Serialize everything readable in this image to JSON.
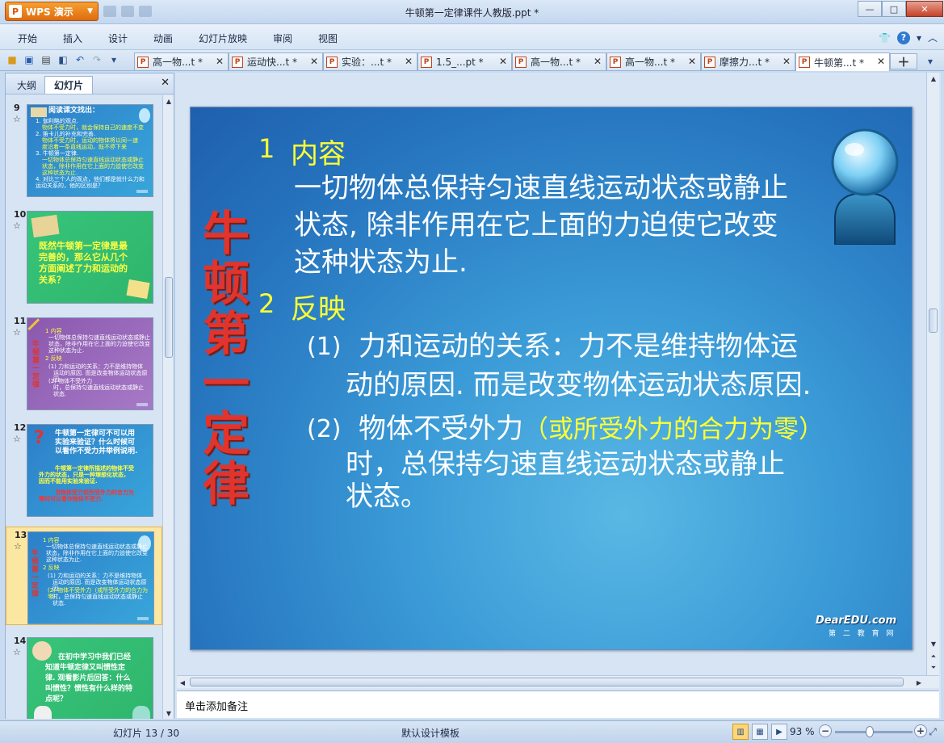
{
  "app": {
    "name": "WPS 演示",
    "logo_letter": "P",
    "window_title": "牛顿第一定律课件人教版.ppt *"
  },
  "menu": [
    "开始",
    "插入",
    "设计",
    "动画",
    "幻灯片放映",
    "审阅",
    "视图"
  ],
  "tabs": [
    {
      "label": "高一物...t *",
      "active": false
    },
    {
      "label": "运动快...t *",
      "active": false
    },
    {
      "label": "实验：...t *",
      "active": false
    },
    {
      "label": "1.5_...pt *",
      "active": false
    },
    {
      "label": "高一物...t *",
      "active": false
    },
    {
      "label": "高一物...t *",
      "active": false
    },
    {
      "label": "摩擦力...t *",
      "active": false
    },
    {
      "label": "牛顿第...t *",
      "active": true
    }
  ],
  "left_panel": {
    "tab_outline": "大纲",
    "tab_slides": "幻灯片"
  },
  "thumbnails": [
    {
      "num": "9",
      "title": "阅读课文找出：",
      "lines": [
        "1. 伽利略的观点.",
        "物体不受力时，就会保持自己的速度不变",
        "2. 笛卡儿的补充和完善.",
        "物体不受力时，运动的物体将以同一速",
        "度沿着一条直线运动，既不停下来",
        "3. 牛顿第一定律.",
        "一切物体总保持匀速直线运动状态或静止",
        "状态，除非作用在它上面的力迫使它改变",
        "这种状态为止.",
        "4. 对比三个人的观点，他们都是就什么力和",
        "运动关系的，他的区别是？"
      ]
    },
    {
      "num": "10",
      "lines": [
        "既然牛顿第一定律是最",
        "完善的，那么它从几个",
        "方面阐述了力和运动的",
        "关系？"
      ]
    },
    {
      "num": "11",
      "lines": [
        "1 内容",
        "一切物体总保持匀速直线运动状态或静止",
        "状态，除非作用在它上面的力迫使它改变",
        "这种状态为止.",
        "2 反映",
        "(1) 力和运动的关系：力不是维持物体",
        "运动的原因. 而是改变物体运动状态原因.",
        "(2) 物体不受外力",
        "时，总保持匀速直线运动状态或静止",
        "状态."
      ],
      "vertical": "牛顿第一定律"
    },
    {
      "num": "12",
      "lines": [
        "牛顿第一定律可不可以用",
        "实验来验证？什么时候可",
        "以看作不受力并举例说明.",
        "牛顿第一定律所描述的物体不受",
        "外力的状态，只是一种理想化状态，",
        "因而不能用实验来验证.",
        "当物体受力但所受外力的合力为",
        "零时可以看作物体不受力."
      ]
    },
    {
      "num": "13",
      "lines": [
        "1 内容",
        "一切物体总保持匀速直线运动状态或静止",
        "状态，除非作用在它上面的力迫使它改变",
        "这种状态为止.",
        "2 反映",
        "(1) 力和运动的关系：力不是维持物体",
        "运动的原因. 而是改变物体运动状态原因.",
        "(2) 物体不受外力（或所受外力的合力为零）",
        "时，总保持匀速直线运动状态或静止",
        "状态."
      ],
      "vertical": "牛顿第一定律"
    },
    {
      "num": "14",
      "lines": [
        "在初中学习中我们已经",
        "知道牛顿定律又叫惯性定",
        "律. 观看影片后回答：什么",
        "叫惯性？惯性有什么样的特",
        "点呢？"
      ]
    }
  ],
  "slide": {
    "vertical_title": [
      "牛",
      "顿",
      "第",
      "一",
      "定",
      "律"
    ],
    "sec1_num": "1",
    "sec1_head": "内容",
    "sec1_lines": [
      "一切物体总保持匀速直线运动状态或静止",
      "状态, 除非作用在它上面的力迫使它改变",
      "这种状态为止."
    ],
    "sec2_num": "2",
    "sec2_head": "反映",
    "p1_num": "(1)",
    "p1_line1": "力和运动的关系：力不是维持物体运",
    "p1_line2": "动的原因. 而是改变物体运动状态原因.",
    "p2_num": "(2)",
    "p2_line1a": "物体不受外力",
    "p2_line1b": "（或所受外力的合力为零）",
    "p2_line2": "时，总保持匀速直线运动状态或静止",
    "p2_line3": "状态。",
    "brand": "DearEDU.com",
    "brand_sub": "第 二 教 育 网"
  },
  "notes_placeholder": "单击添加备注",
  "status": {
    "slide_counter": "幻灯片 13 / 30",
    "template": "默认设计模板",
    "zoom": "93 %"
  },
  "colors": {
    "slide_bg": "#2b7bc6",
    "heading_yellow": "#ffff33",
    "title_red": "#e1342d",
    "accent_orange": "#e06b0e"
  }
}
